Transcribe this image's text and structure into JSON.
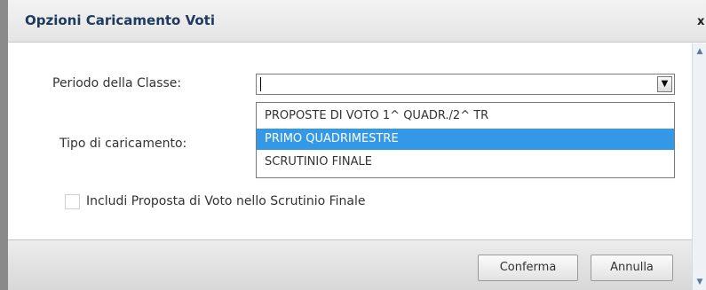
{
  "dialog": {
    "title": "Opzioni Caricamento Voti",
    "close_glyph": "x"
  },
  "form": {
    "periodo_label": "Periodo della Classe:",
    "periodo_value": "",
    "tipo_label": "Tipo di caricamento:",
    "periodo_options": [
      {
        "label": "PROPOSTE DI VOTO 1^ QUADR./2^ TR",
        "highlighted": false
      },
      {
        "label": "PRIMO QUADRIMESTRE",
        "highlighted": true
      },
      {
        "label": "SCRUTINIO FINALE",
        "highlighted": false
      }
    ],
    "checkbox_label": "Includi Proposta di Voto nello Scrutinio Finale",
    "checkbox_checked": false
  },
  "footer": {
    "confirm_label": "Conferma",
    "cancel_label": "Annulla"
  },
  "icons": {
    "dropdown": "chevron-down-icon",
    "close": "close-icon",
    "scroll_up": "scroll-up-icon",
    "scroll_down": "scroll-down-icon"
  },
  "colors": {
    "title_text": "#1e3a5f",
    "highlight": "#3399e6",
    "scrollbar_track": "#eef2f7"
  }
}
